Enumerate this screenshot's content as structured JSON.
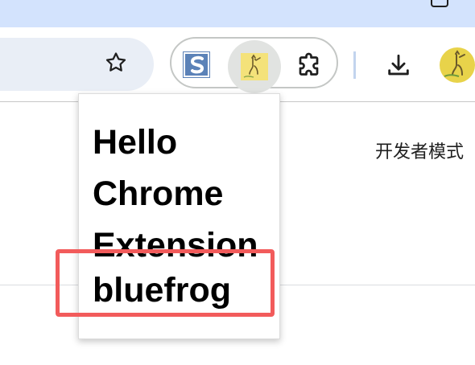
{
  "titlebar": {
    "window_control_icon": "restore-icon"
  },
  "toolbar": {
    "bookmark_icon": "star-icon",
    "extensions": [
      {
        "name": "s-extension",
        "icon": "s-letter-icon"
      },
      {
        "name": "giraffe-extension",
        "icon": "giraffe-icon",
        "active": true
      },
      {
        "name": "extensions-menu",
        "icon": "puzzle-icon"
      }
    ],
    "download_icon": "download-icon",
    "profile_icon": "avatar"
  },
  "page": {
    "developer_mode_label": "开发者模式"
  },
  "popup": {
    "heading": "Hello Chrome Extension",
    "name": "bluefrog"
  },
  "colors": {
    "titlebar": "#d3e3fd",
    "omnibox": "#e9eef6",
    "highlight": "#f25b5b",
    "s_icon": "#5b82b8"
  }
}
